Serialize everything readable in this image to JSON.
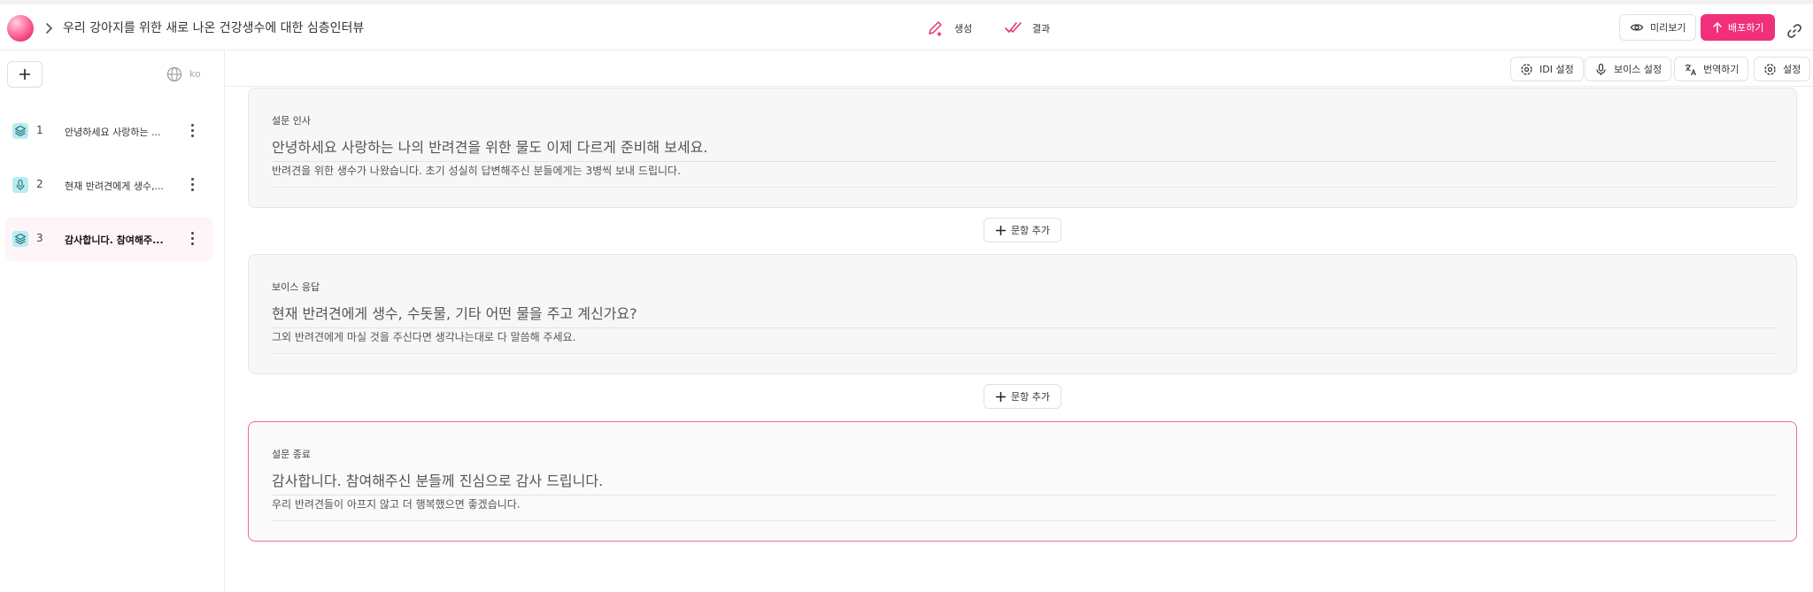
{
  "header": {
    "title": "우리 강아지를 위한 새로 나온 건강생수에 대한 심층인터뷰",
    "tabs": [
      {
        "label": "생성",
        "icon": "pen-plus-icon"
      },
      {
        "label": "결과",
        "icon": "double-check-icon"
      }
    ],
    "preview_label": "미리보기",
    "deploy_label": "배포하기"
  },
  "sidebar": {
    "language": "ko",
    "items": [
      {
        "number": "1",
        "label": "안녕하세요 사랑하는 ...",
        "icon": "layers-icon"
      },
      {
        "number": "2",
        "label": "현재 반려견에게 생수,...",
        "icon": "mic-icon"
      },
      {
        "number": "3",
        "label": "감사합니다. 참여해주...",
        "icon": "layers-icon"
      }
    ]
  },
  "toolbar": {
    "idi_label": "IDI 설정",
    "voice_label": "보이스 설정",
    "translate_label": "번역하기",
    "settings_label": "설정"
  },
  "cards": [
    {
      "type": "설문 인사",
      "title": "안녕하세요 사랑하는 나의 반려견을 위한 물도 이제 다르게 준비해 보세요.",
      "subtitle": "반려견을 위한 생수가 나왔습니다. 초기 성실히 답변해주신 분들에게는 3병씩 보내 드립니다."
    },
    {
      "type": "보이스 응답",
      "title": "현재 반려견에게 생수, 수돗물, 기타 어떤 물을 주고 계신가요?",
      "subtitle": "그외 반려견에게 마실 것을 주신다면 생각나는대로 다 말씀해 주세요."
    },
    {
      "type": "설문 종료",
      "title": "감사합니다. 참여해주신 분들께 진심으로 감사 드립니다.",
      "subtitle": "우리 반려견들이 아프지 않고 더 행복했으면 좋겠습니다."
    }
  ],
  "add_question_label": "문항 추가",
  "colors": {
    "accent": "#f0307a",
    "selected_border": "#f06b8f",
    "item_icon_bg": "#b8ecef"
  }
}
